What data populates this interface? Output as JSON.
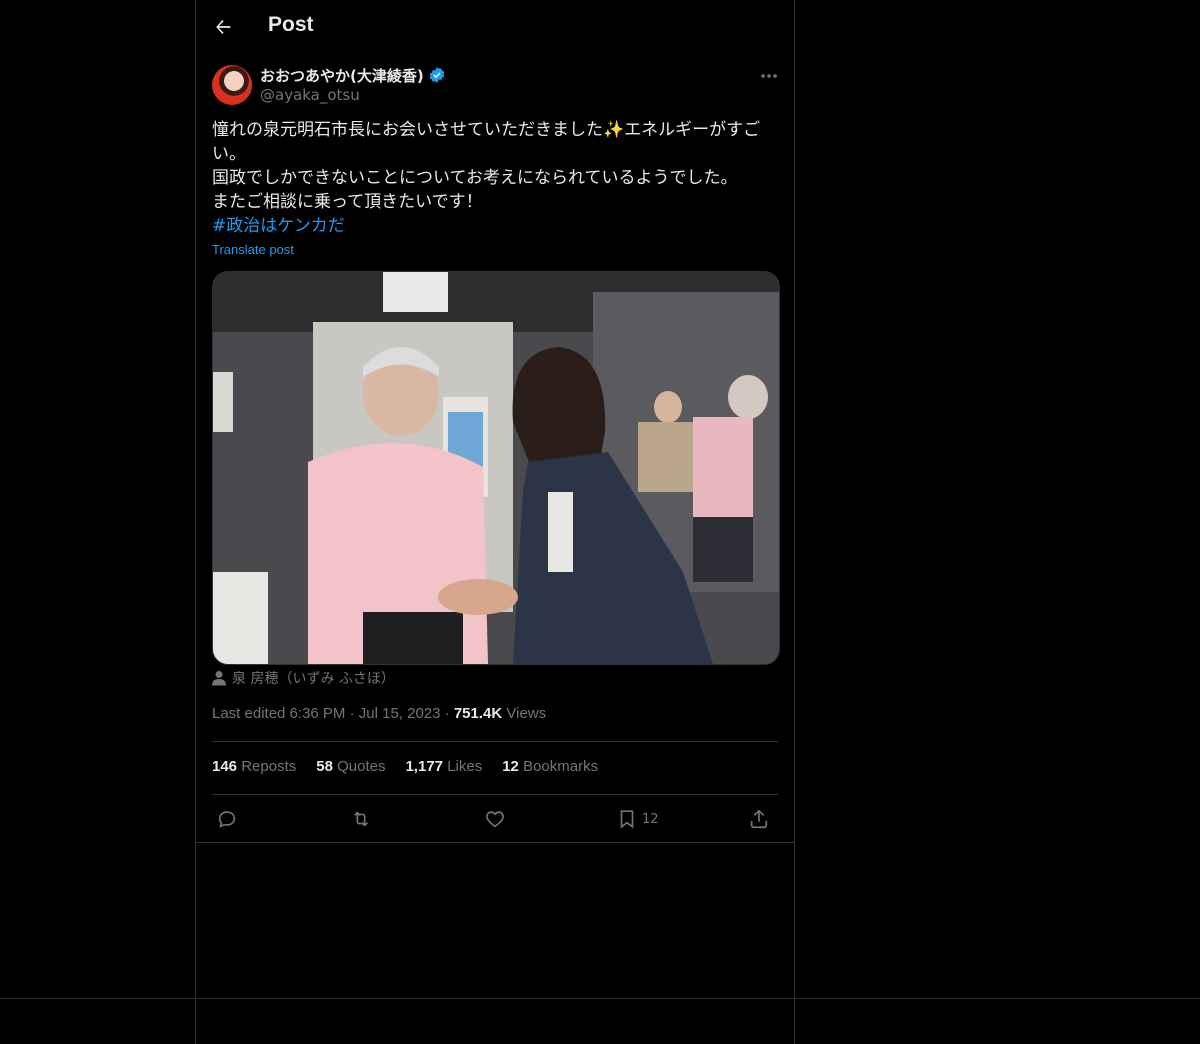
{
  "header": {
    "title": "Post"
  },
  "author": {
    "name": "おおつあやか(大津綾香)",
    "handle": "@ayaka_otsu"
  },
  "post": {
    "text": "憧れの泉元明石市長にお会いさせていただきました✨エネルギーがすごい。\n国政でしかできないことについてお考えになられているようでした。\nまたご相談に乗って頂きたいです！",
    "hashtag": "#政治はケンカだ",
    "translate_label": "Translate post",
    "photo_tag": "泉 房穂（いずみ ふさほ）"
  },
  "meta": {
    "edited": "Last edited 6:36 PM",
    "date": "Jul 15, 2023",
    "views_count": "751.4K",
    "views_label": "Views"
  },
  "stats": {
    "reposts_count": "146",
    "reposts_label": "Reposts",
    "quotes_count": "58",
    "quotes_label": "Quotes",
    "likes_count": "1,177",
    "likes_label": "Likes",
    "bookmarks_count": "12",
    "bookmarks_label": "Bookmarks"
  },
  "actions": {
    "bookmark_count": "12"
  },
  "colors": {
    "accent": "#1d9bf0",
    "background": "#000000",
    "border": "#2f3336",
    "muted": "#71767b"
  }
}
